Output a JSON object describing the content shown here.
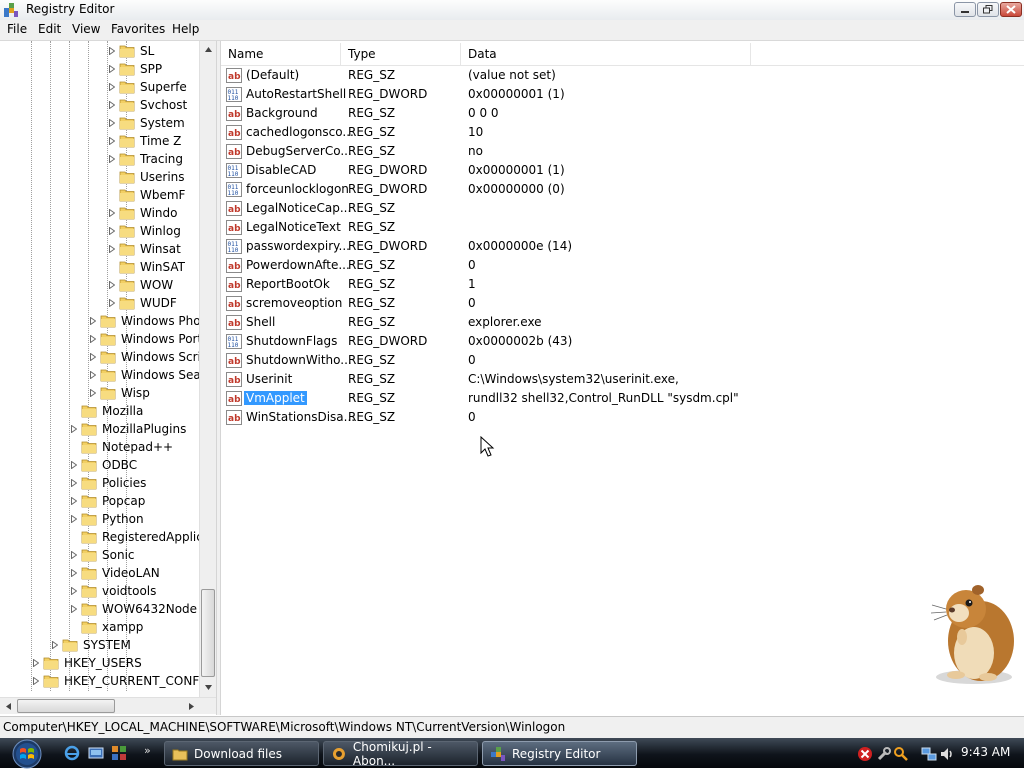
{
  "window": {
    "title": "Registry Editor"
  },
  "menu": [
    "File",
    "Edit",
    "View",
    "Favorites",
    "Help"
  ],
  "tree": [
    {
      "label": "SL",
      "indent": 5,
      "expand": true
    },
    {
      "label": "SPP",
      "indent": 5,
      "expand": true
    },
    {
      "label": "Superfe",
      "indent": 5,
      "expand": true
    },
    {
      "label": "Svchost",
      "indent": 5,
      "expand": true
    },
    {
      "label": "System",
      "indent": 5,
      "expand": true
    },
    {
      "label": "Time Z",
      "indent": 5,
      "expand": true
    },
    {
      "label": "Tracing",
      "indent": 5,
      "expand": true
    },
    {
      "label": "Userins",
      "indent": 5,
      "expand": false
    },
    {
      "label": "WbemF",
      "indent": 5,
      "expand": false
    },
    {
      "label": "Windo",
      "indent": 5,
      "expand": true
    },
    {
      "label": "Winlog",
      "indent": 5,
      "expand": true
    },
    {
      "label": "Winsat",
      "indent": 5,
      "expand": true
    },
    {
      "label": "WinSAT",
      "indent": 5,
      "expand": false
    },
    {
      "label": "WOW",
      "indent": 5,
      "expand": true
    },
    {
      "label": "WUDF",
      "indent": 5,
      "expand": true
    },
    {
      "label": "Windows Phot",
      "indent": 4,
      "expand": true
    },
    {
      "label": "Windows Porta",
      "indent": 4,
      "expand": true
    },
    {
      "label": "Windows Scrip",
      "indent": 4,
      "expand": true
    },
    {
      "label": "Windows Sear",
      "indent": 4,
      "expand": true
    },
    {
      "label": "Wisp",
      "indent": 4,
      "expand": true
    },
    {
      "label": "Mozilla",
      "indent": 3,
      "expand": false
    },
    {
      "label": "MozillaPlugins",
      "indent": 3,
      "expand": true
    },
    {
      "label": "Notepad++",
      "indent": 3,
      "expand": false
    },
    {
      "label": "ODBC",
      "indent": 3,
      "expand": true
    },
    {
      "label": "Policies",
      "indent": 3,
      "expand": true
    },
    {
      "label": "Popcap",
      "indent": 3,
      "expand": true
    },
    {
      "label": "Python",
      "indent": 3,
      "expand": true
    },
    {
      "label": "RegisteredApplica",
      "indent": 3,
      "expand": false
    },
    {
      "label": "Sonic",
      "indent": 3,
      "expand": true
    },
    {
      "label": "VideoLAN",
      "indent": 3,
      "expand": true
    },
    {
      "label": "voidtools",
      "indent": 3,
      "expand": true
    },
    {
      "label": "WOW6432Node",
      "indent": 3,
      "expand": true
    },
    {
      "label": "xampp",
      "indent": 3,
      "expand": false
    },
    {
      "label": "SYSTEM",
      "indent": 2,
      "expand": true
    },
    {
      "label": "HKEY_USERS",
      "indent": 1,
      "expand": true
    },
    {
      "label": "HKEY_CURRENT_CONFIG",
      "indent": 1,
      "expand": true
    }
  ],
  "columns": [
    "Name",
    "Type",
    "Data"
  ],
  "values": [
    {
      "name": "(Default)",
      "type": "REG_SZ",
      "data": "(value not set)",
      "icon": "string"
    },
    {
      "name": "AutoRestartShell",
      "type": "REG_DWORD",
      "data": "0x00000001 (1)",
      "icon": "binary"
    },
    {
      "name": "Background",
      "type": "REG_SZ",
      "data": "0 0 0",
      "icon": "string"
    },
    {
      "name": "cachedlogonsco...",
      "type": "REG_SZ",
      "data": "10",
      "icon": "string"
    },
    {
      "name": "DebugServerCo...",
      "type": "REG_SZ",
      "data": "no",
      "icon": "string"
    },
    {
      "name": "DisableCAD",
      "type": "REG_DWORD",
      "data": "0x00000001 (1)",
      "icon": "binary"
    },
    {
      "name": "forceunlocklogon",
      "type": "REG_DWORD",
      "data": "0x00000000 (0)",
      "icon": "binary"
    },
    {
      "name": "LegalNoticeCap...",
      "type": "REG_SZ",
      "data": "",
      "icon": "string"
    },
    {
      "name": "LegalNoticeText",
      "type": "REG_SZ",
      "data": "",
      "icon": "string"
    },
    {
      "name": "passwordexpiry...",
      "type": "REG_DWORD",
      "data": "0x0000000e (14)",
      "icon": "binary"
    },
    {
      "name": "PowerdownAfte...",
      "type": "REG_SZ",
      "data": "0",
      "icon": "string"
    },
    {
      "name": "ReportBootOk",
      "type": "REG_SZ",
      "data": "1",
      "icon": "string"
    },
    {
      "name": "scremoveoption",
      "type": "REG_SZ",
      "data": "0",
      "icon": "string"
    },
    {
      "name": "Shell",
      "type": "REG_SZ",
      "data": "explorer.exe",
      "icon": "string"
    },
    {
      "name": "ShutdownFlags",
      "type": "REG_DWORD",
      "data": "0x0000002b (43)",
      "icon": "binary"
    },
    {
      "name": "ShutdownWitho...",
      "type": "REG_SZ",
      "data": "0",
      "icon": "string"
    },
    {
      "name": "Userinit",
      "type": "REG_SZ",
      "data": "C:\\Windows\\system32\\userinit.exe,",
      "icon": "string"
    },
    {
      "name": "VmApplet",
      "type": "REG_SZ",
      "data": "rundll32 shell32,Control_RunDLL \"sysdm.cpl\"",
      "icon": "string",
      "selected": true
    },
    {
      "name": "WinStationsDisa...",
      "type": "REG_SZ",
      "data": "0",
      "icon": "string"
    }
  ],
  "statusbar": {
    "path": "Computer\\HKEY_LOCAL_MACHINE\\SOFTWARE\\Microsoft\\Windows NT\\CurrentVersion\\Winlogon"
  },
  "taskbar": {
    "buttons": [
      {
        "label": "Download files",
        "active": false
      },
      {
        "label": "Chomikuj.pl - Abon...",
        "active": false
      },
      {
        "label": "Registry Editor",
        "active": true
      }
    ],
    "clock": "9:43 AM"
  },
  "icons": {
    "app": "registry-editor-icon",
    "folder": "folder-icon",
    "string": "reg-sz-icon",
    "binary": "reg-dword-icon",
    "start": "windows-start-orb-icon",
    "mascot": "hamster-icon"
  }
}
